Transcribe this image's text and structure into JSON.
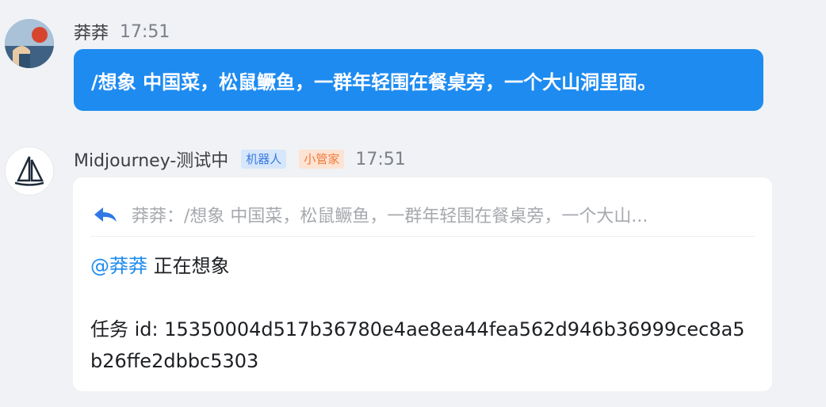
{
  "messages": {
    "user": {
      "name": "莽莽",
      "time": "17:51",
      "text": "/想象 中国菜，松鼠鳜鱼，一群年轻围在餐桌旁，一个大山洞里面。"
    },
    "bot": {
      "name": "Midjourney-测试中",
      "tag_bot": "机器人",
      "tag_manager": "小管家",
      "time": "17:51",
      "reply_preview": "莽莽：/想象 中国菜，松鼠鳜鱼，一群年轻围在餐桌旁，一个大山...",
      "mention": "@莽莽",
      "status": "正在想象",
      "task_label": "任务 id: ",
      "task_id": "15350004d517b36780e4ae8ea44fea562d946b36999cec8a5b26ffe2dbbc5303"
    }
  },
  "icons": {
    "user_avatar": "user-avatar-photo",
    "bot_avatar": "sailboat-logo",
    "reply": "reply-arrow-icon"
  },
  "colors": {
    "accent": "#1e8bf0",
    "background": "#f0f2f5",
    "tag_bot": "#3a7be0",
    "tag_manager": "#f07a3a"
  }
}
